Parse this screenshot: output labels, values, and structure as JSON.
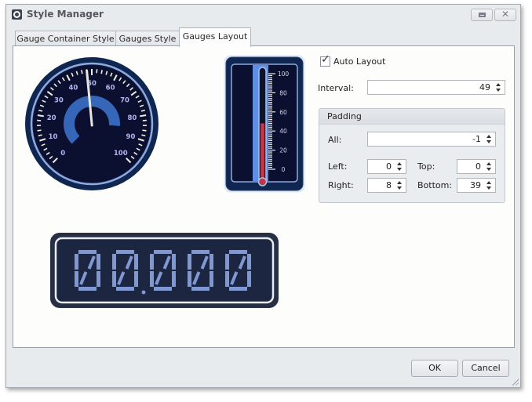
{
  "window": {
    "title": "Style Manager",
    "maximize_icon": "maximize-icon",
    "close_icon": "close-icon"
  },
  "tabs": [
    {
      "label": "Gauge Container Style",
      "active": false
    },
    {
      "label": "Gauges Style",
      "active": false
    },
    {
      "label": "Gauges Layout",
      "active": true
    }
  ],
  "preview": {
    "circular_gauge": {
      "scale_min": 0,
      "scale_max": 100,
      "labels": [
        "0",
        "10",
        "20",
        "30",
        "40",
        "50",
        "60",
        "70",
        "80",
        "90",
        "100"
      ],
      "needle_value": 48,
      "range_bar_value": 85
    },
    "linear_gauge": {
      "scale_min": 0,
      "scale_max": 100,
      "labels": [
        "0",
        "20",
        "40",
        "60",
        "80",
        "100"
      ],
      "level_value": 48
    },
    "digital_gauge": {
      "text": "00.000"
    }
  },
  "layout": {
    "auto_layout": {
      "label": "Auto Layout",
      "checked": true
    },
    "interval": {
      "label": "Interval:",
      "value": "49"
    },
    "padding": {
      "title": "Padding",
      "all": {
        "label": "All:",
        "value": "-1"
      },
      "left": {
        "label": "Left:",
        "value": "0"
      },
      "top": {
        "label": "Top:",
        "value": "0"
      },
      "right": {
        "label": "Right:",
        "value": "8"
      },
      "bottom": {
        "label": "Bottom:",
        "value": "39"
      }
    }
  },
  "footer": {
    "ok_label": "OK",
    "cancel_label": "Cancel"
  },
  "colors": {
    "gauge_bg": "#0b1030",
    "gauge_frame": "#0f2650",
    "gauge_ring": "#8fa9dc",
    "range_bar": "#3566b8",
    "label_color": "#b7b4f0",
    "thermo_fill": "#c03848",
    "digit_color": "#7f97d2"
  }
}
